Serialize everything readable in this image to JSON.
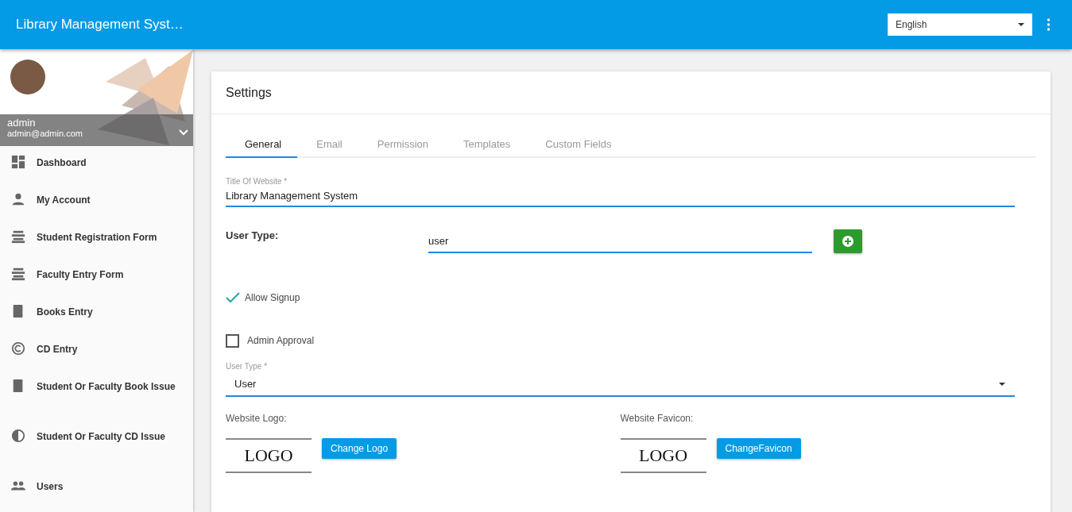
{
  "app_bar": {
    "title": "Library Management Syst…",
    "language": {
      "value": "English"
    }
  },
  "profile": {
    "name": "admin",
    "email": "admin@admin.com"
  },
  "sidebar": {
    "items": [
      {
        "label": "Dashboard"
      },
      {
        "label": "My Account"
      },
      {
        "label": "Student Registration Form"
      },
      {
        "label": "Faculty Entry Form"
      },
      {
        "label": "Books Entry"
      },
      {
        "label": "CD Entry"
      },
      {
        "label": "Student Or Faculty Book Issue"
      },
      {
        "label": "Student Or Faculty CD Issue"
      },
      {
        "label": "Users"
      }
    ]
  },
  "settings": {
    "title": "Settings",
    "tabs": [
      {
        "label": "General",
        "selected": true
      },
      {
        "label": "Email",
        "selected": false
      },
      {
        "label": "Permission",
        "selected": false
      },
      {
        "label": "Templates",
        "selected": false
      },
      {
        "label": "Custom Fields",
        "selected": false
      }
    ],
    "website_title": {
      "label": "Title Of Website *",
      "value": "Library Management System"
    },
    "user_type_entry": {
      "label": "User Type:",
      "value": "user"
    },
    "allow_signup": {
      "label": "Allow Signup",
      "checked": true
    },
    "admin_approval": {
      "label": "Admin Approval",
      "checked": false
    },
    "user_type_select": {
      "label": "User Type *",
      "value": "User"
    },
    "logo": {
      "label": "Website Logo:",
      "preview": "LOGO",
      "button": "Change Logo"
    },
    "favicon": {
      "label": "Website Favicon:",
      "preview": "LOGO",
      "button": "ChangeFavicon"
    }
  }
}
